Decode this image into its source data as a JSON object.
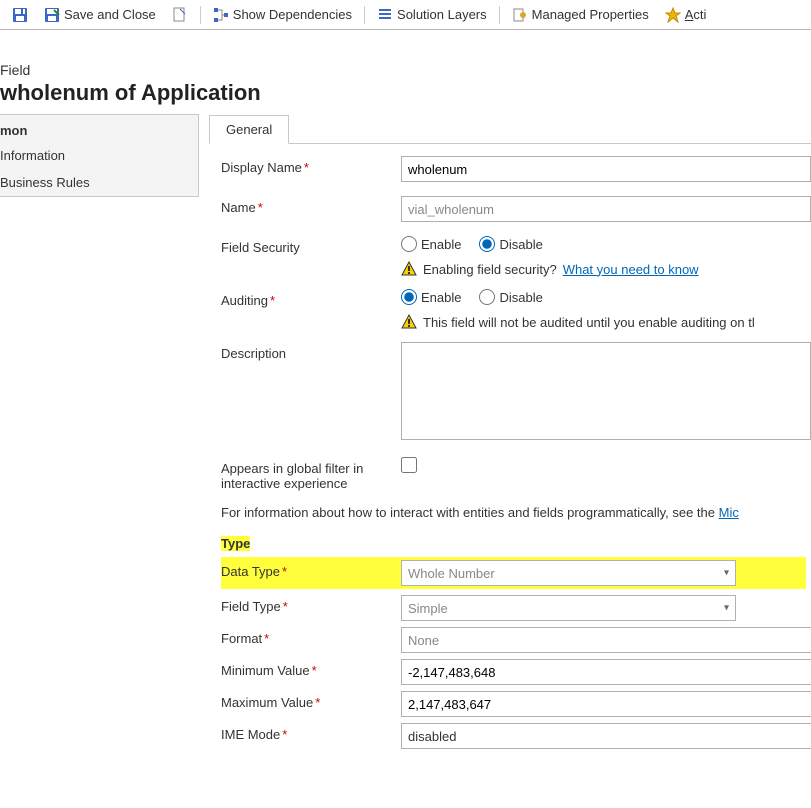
{
  "toolbar": {
    "save_close": "Save and Close",
    "show_dependencies": "Show Dependencies",
    "solution_layers": "Solution Layers",
    "managed_properties": "Managed Properties",
    "actions_prefix": "A",
    "actions_rest": "cti"
  },
  "header": {
    "kind": "Field",
    "title": "wholenum of Application"
  },
  "sidenav": {
    "category": "mon",
    "items": [
      {
        "label": "Information"
      },
      {
        "label": "Business Rules"
      }
    ]
  },
  "tabs": {
    "general": "General"
  },
  "form": {
    "display_name": {
      "label": "Display Name",
      "value": "wholenum"
    },
    "name": {
      "label": "Name",
      "value": "vial_wholenum"
    },
    "field_security": {
      "label": "Field Security",
      "enable": "Enable",
      "disable": "Disable",
      "value": "disable",
      "warn_text": "Enabling field security? ",
      "warn_link": "What you need to know"
    },
    "auditing": {
      "label": "Auditing",
      "enable": "Enable",
      "disable": "Disable",
      "value": "enable",
      "warn_text": "This field will not be audited until you enable auditing on tl"
    },
    "description": {
      "label": "Description",
      "value": ""
    },
    "global_filter": {
      "label": "Appears in global filter in interactive experience",
      "checked": false
    },
    "info_text": "For information about how to interact with entities and fields programmatically, see the ",
    "info_link": "Mic",
    "type_section": "Type",
    "data_type": {
      "label": "Data Type",
      "value": "Whole Number"
    },
    "field_type": {
      "label": "Field Type",
      "value": "Simple"
    },
    "format": {
      "label": "Format",
      "value": "None"
    },
    "min_value": {
      "label": "Minimum Value",
      "value": "-2,147,483,648"
    },
    "max_value": {
      "label": "Maximum Value",
      "value": "2,147,483,647"
    },
    "ime_mode": {
      "label": "IME Mode",
      "value": "disabled"
    }
  }
}
